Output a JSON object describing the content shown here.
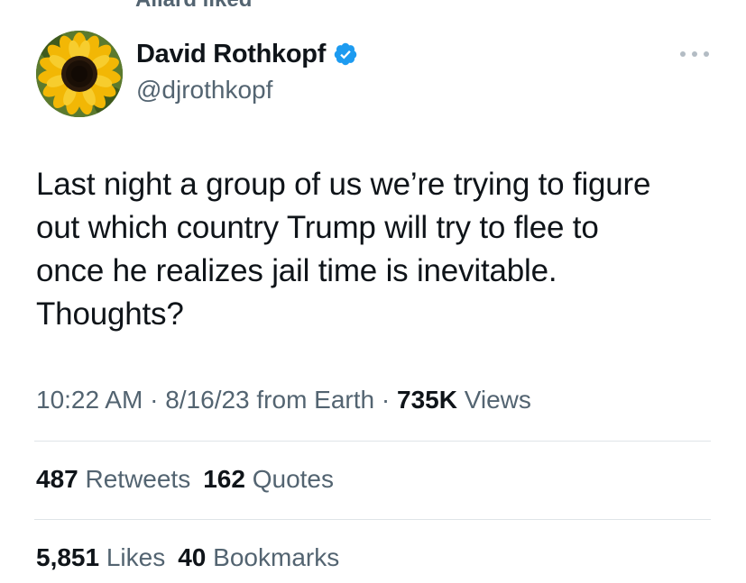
{
  "social_context": {
    "text": "Allard liked"
  },
  "author": {
    "display_name": "David Rothkopf",
    "handle": "@djrothkopf",
    "verified": true,
    "avatar": "sunflower-avatar"
  },
  "tweet": {
    "lines": [
      "Last night a group of us we’re trying to figure",
      "out which country Trump will try to flee to",
      "once he realizes jail time is inevitable.",
      "Thoughts?"
    ]
  },
  "meta": {
    "time": "10:22 AM",
    "separator": " · ",
    "date": "8/16/23",
    "source": " from Earth",
    "views_count": "735K",
    "views_label": " Views"
  },
  "stats": {
    "retweets_count": "487",
    "retweets_label": " Retweets",
    "quotes_count": "162",
    "quotes_label": " Quotes",
    "likes_count": "5,851",
    "likes_label": " Likes",
    "bookmarks_count": "40",
    "bookmarks_label": " Bookmarks"
  },
  "colors": {
    "primary_text": "#0f1419",
    "secondary_text": "#536471",
    "verified_blue": "#1d9bf0",
    "divider": "#dfe4e8"
  },
  "icons": [
    "sunflower-avatar",
    "verified-badge-icon",
    "more-options-icon"
  ]
}
